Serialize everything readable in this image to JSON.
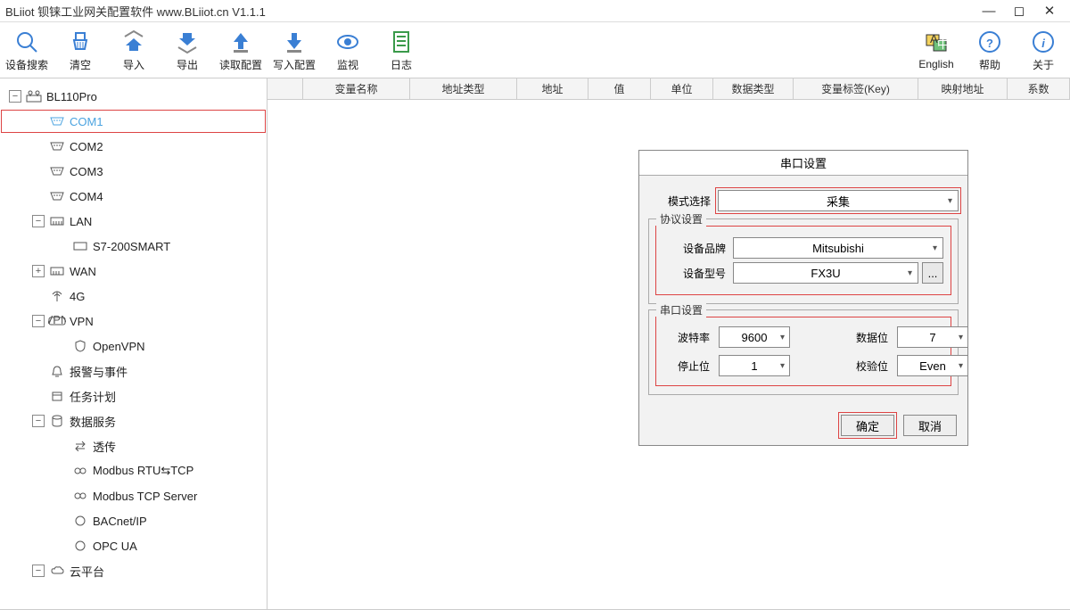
{
  "window": {
    "title": "BLiiot  钡铼工业网关配置软件 www.BLiiot.cn V1.1.1"
  },
  "toolbar": {
    "search": "设备搜索",
    "clear": "清空",
    "import": "导入",
    "export": "导出",
    "read": "读取配置",
    "write": "写入配置",
    "monitor": "监视",
    "log": "日志",
    "english": "English",
    "help": "帮助",
    "about": "关于"
  },
  "tree": {
    "root": "BL110Pro",
    "com1": "COM1",
    "com2": "COM2",
    "com3": "COM3",
    "com4": "COM4",
    "lan": "LAN",
    "s7": "S7-200SMART",
    "wan": "WAN",
    "g4": "4G",
    "vpn": "VPN",
    "openvpn": "OpenVPN",
    "alarm": "报警与事件",
    "task": "任务计划",
    "dataservice": "数据服务",
    "passthru": "透传",
    "modbusrtu": "Modbus RTU⇆TCP",
    "modbustcp": "Modbus TCP Server",
    "bacnet": "BACnet/IP",
    "opcua": "OPC UA",
    "cloud": "云平台"
  },
  "columns": {
    "varname": "变量名称",
    "addrtype": "地址类型",
    "addr": "地址",
    "value": "值",
    "unit": "单位",
    "datatype": "数据类型",
    "varlabel": "变量标签(Key)",
    "mapaddr": "映射地址",
    "coeff": "系数"
  },
  "dialog": {
    "title": "串口设置",
    "mode_label": "模式选择",
    "mode_value": "采集",
    "protocol_legend": "协议设置",
    "brand_label": "设备品牌",
    "brand_value": "Mitsubishi",
    "model_label": "设备型号",
    "model_value": "FX3U",
    "serial_legend": "串口设置",
    "baud_label": "波特率",
    "baud_value": "9600",
    "databit_label": "数据位",
    "databit_value": "7",
    "stopbit_label": "停止位",
    "stopbit_value": "1",
    "parity_label": "校验位",
    "parity_value": "Even",
    "ok": "确定",
    "cancel": "取消",
    "more": "..."
  }
}
